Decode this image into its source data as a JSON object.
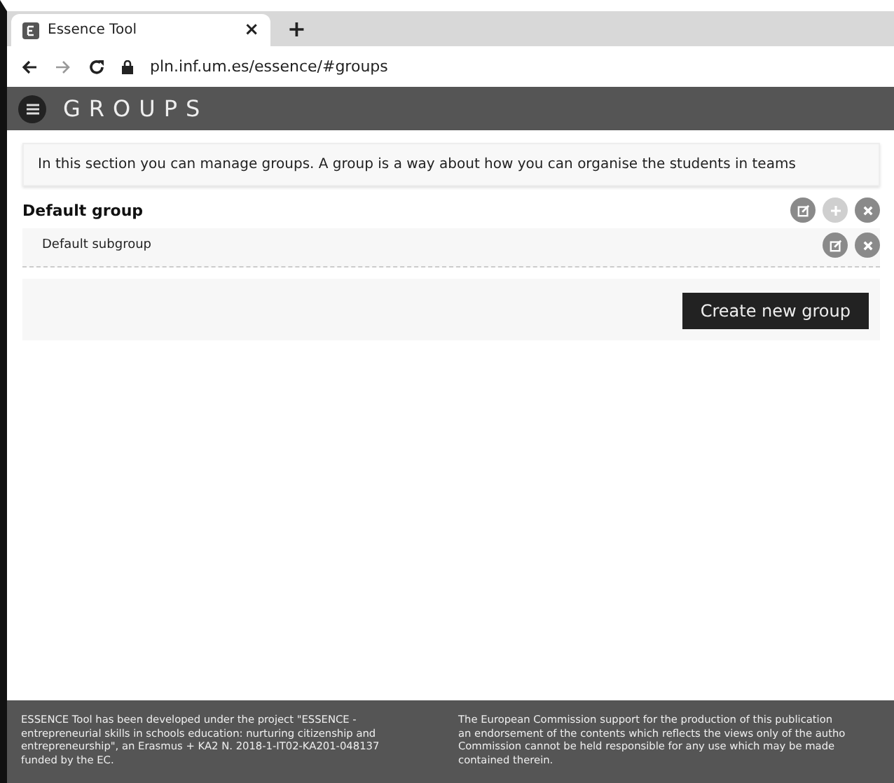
{
  "browser": {
    "tab_title": "Essence Tool",
    "tab_close": "×",
    "new_tab": "+",
    "url": "pln.inf.um.es/essence/#groups"
  },
  "header": {
    "title": "GROUPS"
  },
  "intro": "In this section you can manage groups. A group is a way about how you can organise the students in teams",
  "groups": [
    {
      "name": "Default group",
      "actions": [
        {
          "kind": "edit",
          "disabled": false
        },
        {
          "kind": "add",
          "disabled": true
        },
        {
          "kind": "delete",
          "disabled": false
        }
      ],
      "subgroups": [
        {
          "name": "Default subgroup",
          "actions": [
            {
              "kind": "edit",
              "disabled": false
            },
            {
              "kind": "delete",
              "disabled": false
            }
          ]
        }
      ]
    }
  ],
  "create_button": "Create new group",
  "footer": {
    "left": [
      "ESSENCE Tool has been developed under the project \"ESSENCE -",
      "entrepreneurial skills in schools education: nurturing citizenship and",
      "entrepreneurship\", an Erasmus + KA2 N. 2018-1-IT02-KA201-048137",
      "funded by the EC."
    ],
    "right": [
      "The European Commission support for the production of this publication",
      "an endorsement of the contents which reflects the views only of the autho",
      "Commission cannot be held responsible for any use which may be made",
      "contained therein."
    ]
  }
}
